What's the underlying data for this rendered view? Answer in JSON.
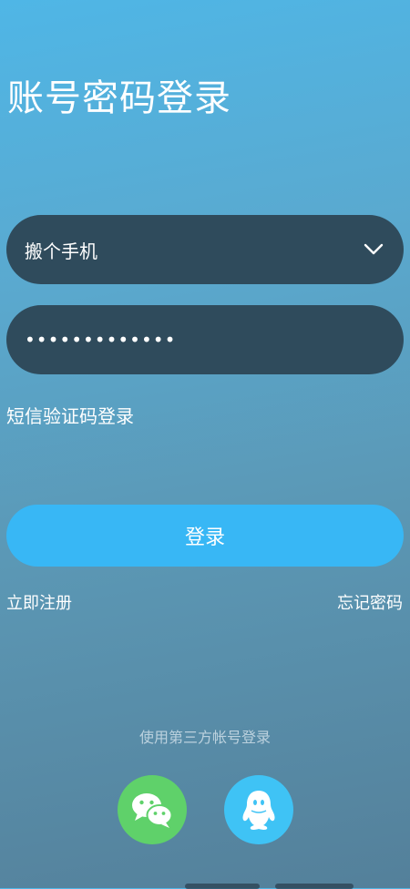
{
  "header": {
    "title": "账号密码登录"
  },
  "form": {
    "account": {
      "value": "搬个手机",
      "dropdown_icon": "chevron-down-icon"
    },
    "password": {
      "masked_value": "•••••••••••••"
    },
    "sms_login_label": "短信验证码登录",
    "login_button_label": "登录"
  },
  "links": {
    "register": "立即注册",
    "forgot_password": "忘记密码"
  },
  "third_party": {
    "label": "使用第三方帐号登录",
    "providers": [
      {
        "icon": "wechat-icon",
        "color": "#5fd16a"
      },
      {
        "icon": "qq-icon",
        "color": "#3fc3f5"
      }
    ]
  },
  "colors": {
    "field_background": "#2f4b5c",
    "login_button": "#38b7f5"
  }
}
